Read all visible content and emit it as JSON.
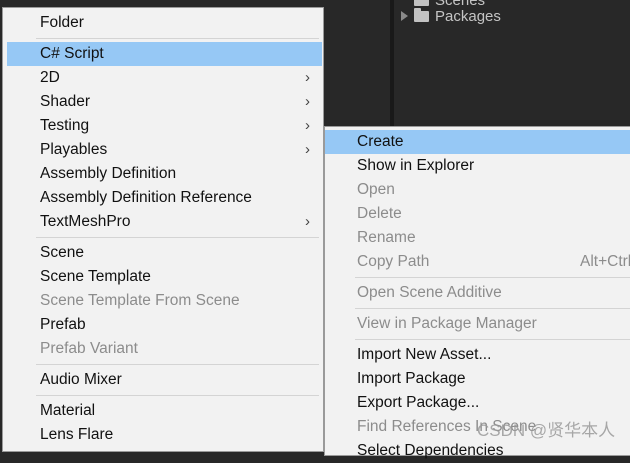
{
  "project_tree": {
    "items": [
      {
        "label": "Scenes"
      },
      {
        "label": "Packages"
      }
    ]
  },
  "create_menu": {
    "items": [
      {
        "label": "Folder"
      },
      {
        "label": "C# Script"
      },
      {
        "label": "2D"
      },
      {
        "label": "Shader"
      },
      {
        "label": "Testing"
      },
      {
        "label": "Playables"
      },
      {
        "label": "Assembly Definition"
      },
      {
        "label": "Assembly Definition Reference"
      },
      {
        "label": "TextMeshPro"
      },
      {
        "label": "Scene"
      },
      {
        "label": "Scene Template"
      },
      {
        "label": "Scene Template From Scene"
      },
      {
        "label": "Prefab"
      },
      {
        "label": "Prefab Variant"
      },
      {
        "label": "Audio Mixer"
      },
      {
        "label": "Material"
      },
      {
        "label": "Lens Flare"
      }
    ]
  },
  "context_menu": {
    "items": [
      {
        "label": "Create"
      },
      {
        "label": "Show in Explorer"
      },
      {
        "label": "Open"
      },
      {
        "label": "Delete"
      },
      {
        "label": "Rename"
      },
      {
        "label": "Copy Path",
        "shortcut": "Alt+Ctrl+C"
      },
      {
        "label": "Open Scene Additive"
      },
      {
        "label": "View in Package Manager"
      },
      {
        "label": "Import New Asset..."
      },
      {
        "label": "Import Package"
      },
      {
        "label": "Export Package..."
      },
      {
        "label": "Find References In Scene"
      },
      {
        "label": "Select Dependencies"
      }
    ]
  },
  "watermark": "CSDN @贤华本人",
  "colors": {
    "highlight": "#96c8f5",
    "menu_bg": "#f2f2f2",
    "editor_bg": "#282828",
    "disabled_text": "#8c8c8c"
  }
}
